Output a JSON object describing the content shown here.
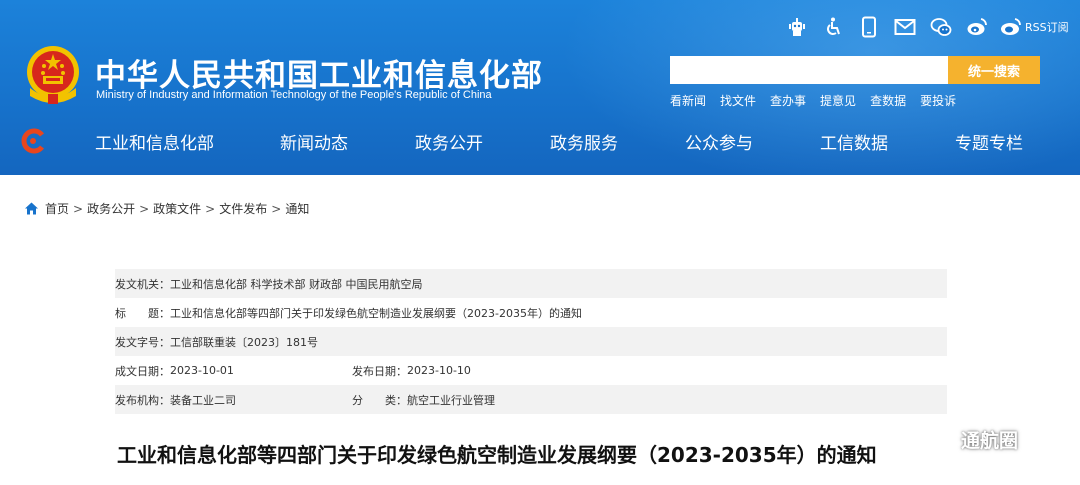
{
  "header": {
    "title": "中华人民共和国工业和信息化部",
    "subtitle": "Ministry of Industry and Information Technology of the People's Republic of China",
    "utility_icons": [
      "robot-icon",
      "accessibility-icon",
      "mobile-icon",
      "mail-icon",
      "wechat-icon",
      "weibo-icon"
    ],
    "rss_label": "RSS订阅",
    "search": {
      "placeholder": "",
      "button_label": "统一搜索"
    },
    "quick_links": [
      "看新闻",
      "找文件",
      "查办事",
      "提意见",
      "查数据",
      "要投诉"
    ],
    "nav": [
      "工业和信息化部",
      "新闻动态",
      "政务公开",
      "政务服务",
      "公众参与",
      "工信数据",
      "专题专栏"
    ],
    "colors": {
      "header_blue": "#1773cc",
      "search_button": "#f5b22e",
      "emblem_red": "#d7261c",
      "emblem_gold": "#f2c200"
    }
  },
  "breadcrumb": {
    "items": [
      "首页",
      "政务公开",
      "政策文件",
      "文件发布",
      "通知"
    ],
    "separator": ">"
  },
  "meta": {
    "issuer_label": "发文机关：",
    "issuer_value": "工业和信息化部 科学技术部 财政部 中国民用航空局",
    "title_label_1": "标",
    "title_label_2": "题：",
    "title_value": "工业和信息化部等四部门关于印发绿色航空制造业发展纲要（2023-2035年）的通知",
    "docno_label": "发文字号：",
    "docno_value": "工信部联重装〔2023〕181号",
    "created_label": "成文日期：",
    "created_value": "2023-10-01",
    "published_label": "发布日期：",
    "published_value": "2023-10-10",
    "org_label": "发布机构：",
    "org_value": "装备工业二司",
    "category_label_1": "分",
    "category_label_2": "类：",
    "category_value": "航空工业行业管理"
  },
  "article": {
    "title": "工业和信息化部等四部门关于印发绿色航空制造业发展纲要（2023-2035年）的通知"
  },
  "watermark": {
    "text": "通航圈"
  }
}
